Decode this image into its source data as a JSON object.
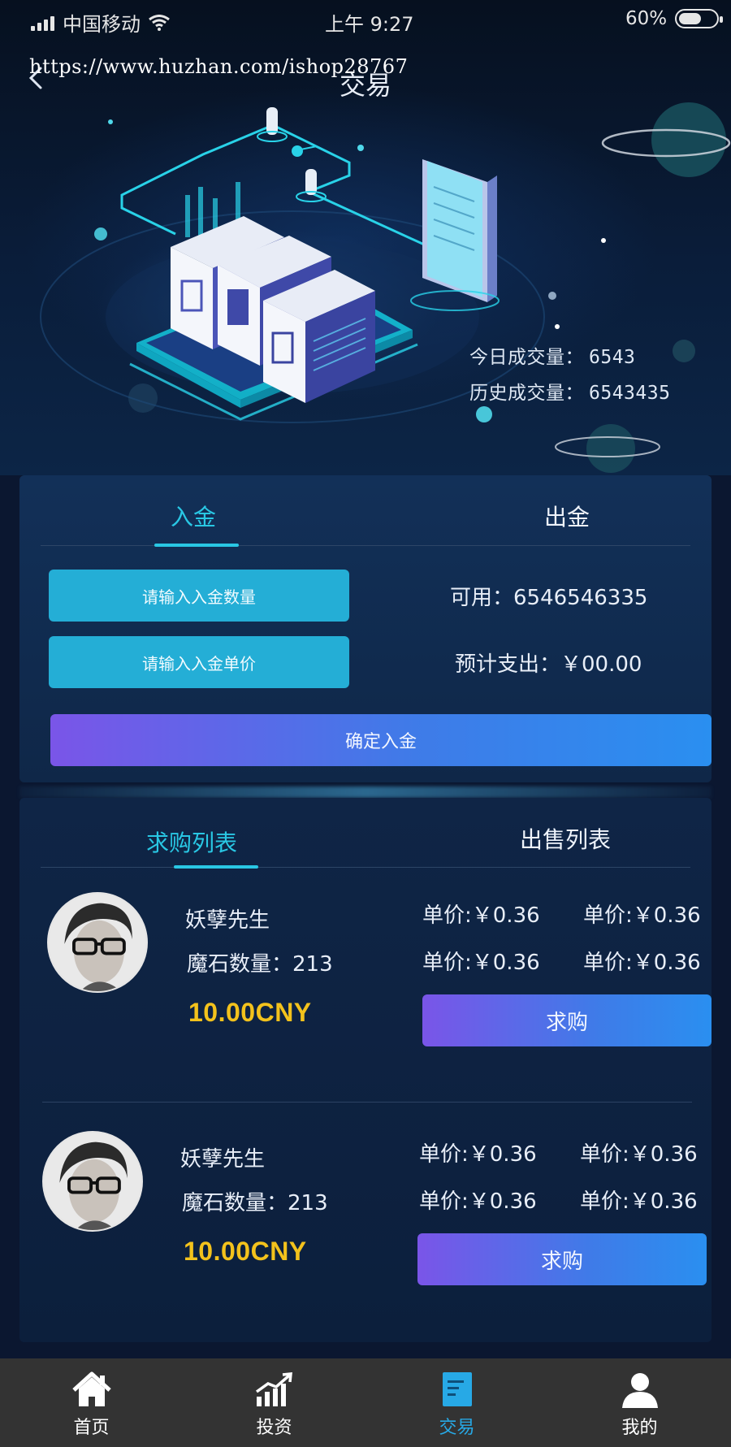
{
  "status_bar": {
    "carrier": "中国移动",
    "time": "上午 9:27",
    "battery": "60%",
    "battery_level": 0.6
  },
  "watermark": "https://www.huzhan.com/ishop28767",
  "header": {
    "title": "交易"
  },
  "hero": {
    "today_label": "今日成交量：",
    "today_value": "6543",
    "history_label": "历史成交量：",
    "history_value": "6543435"
  },
  "deposit": {
    "tabs": [
      {
        "label": "入金",
        "active": true
      },
      {
        "label": "出金",
        "active": false
      }
    ],
    "amount_placeholder": "请输入入金数量",
    "price_placeholder": "请输入入金单价",
    "available_label": "可用：",
    "available_value": "6546546335",
    "estimate_label": "预计支出：",
    "estimate_value": "￥00.00",
    "confirm_label": "确定入金"
  },
  "market": {
    "tabs": [
      {
        "label": "求购列表",
        "active": true
      },
      {
        "label": "出售列表",
        "active": false
      }
    ],
    "items": [
      {
        "name": "妖孽先生",
        "qty_label": "魔石数量：",
        "qty": "213",
        "total": "10.00CNY",
        "unit_prices": [
          "单价:￥0.36",
          "单价:￥0.36",
          "单价:￥0.36",
          "单价:￥0.36"
        ],
        "button": "求购"
      },
      {
        "name": "妖孽先生",
        "qty_label": "魔石数量：",
        "qty": "213",
        "total": "10.00CNY",
        "unit_prices": [
          "单价:￥0.36",
          "单价:￥0.36",
          "单价:￥0.36",
          "单价:￥0.36"
        ],
        "button": "求购"
      }
    ]
  },
  "bottom_nav": [
    {
      "label": "首页",
      "icon": "home-icon",
      "active": false
    },
    {
      "label": "投资",
      "icon": "chart-icon",
      "active": false
    },
    {
      "label": "交易",
      "icon": "document-icon",
      "active": true
    },
    {
      "label": "我的",
      "icon": "user-icon",
      "active": false
    }
  ],
  "colors": {
    "accent": "#29c7e4",
    "button_cyan": "#24aed6",
    "gradient_start": "#7a55e8",
    "gradient_end": "#2a8ff0",
    "price_gold": "#f3c21c",
    "nav_active": "#27a9e6"
  }
}
